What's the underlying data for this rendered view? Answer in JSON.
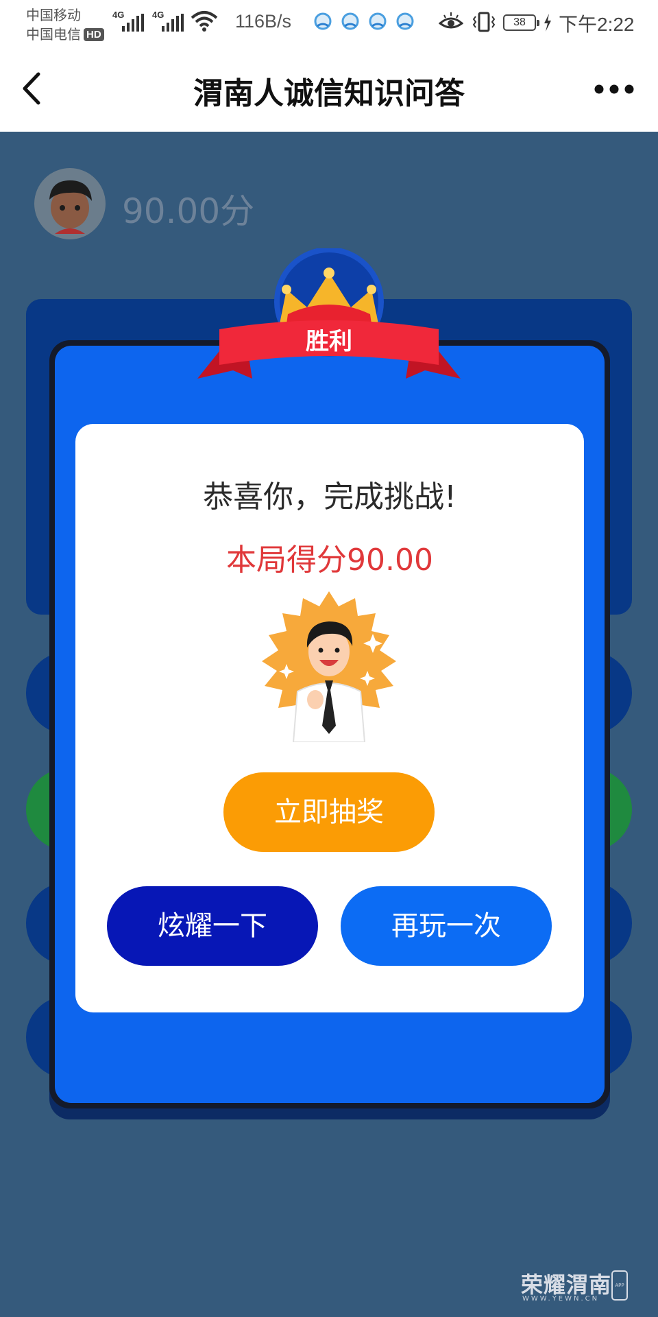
{
  "status_bar": {
    "carrier_1": "中国移动",
    "carrier_2": "中国电信",
    "hd_badge": "HD",
    "network_1": "4G",
    "network_2": "4G",
    "speed": "116B/s",
    "battery": "38",
    "time": "下午2:22"
  },
  "nav": {
    "title": "渭南人诚信知识问答",
    "back_icon": "chevron-left-icon",
    "more_icon": "more-dots-icon"
  },
  "background_page": {
    "score": "90.00分"
  },
  "modal": {
    "ribbon_label": "胜利",
    "congrats": "恭喜你，完成挑战!",
    "score_line": "本局得分90.00",
    "lottery_button": "立即抽奖",
    "share_button": "炫耀一下",
    "replay_button": "再玩一次"
  },
  "watermark": {
    "text": "荣耀渭南",
    "sub": "WWW.YEWN.CN",
    "app_badge": "APP"
  },
  "colors": {
    "background": "#355a7c",
    "modal_blue": "#0d65ee",
    "lottery_orange": "#fb9c05",
    "share_navy": "#0717b6",
    "replay_blue": "#0c6cf4",
    "score_red": "#e0383a",
    "ribbon_red": "#f0283a",
    "crown_gold": "#f6b52a"
  }
}
